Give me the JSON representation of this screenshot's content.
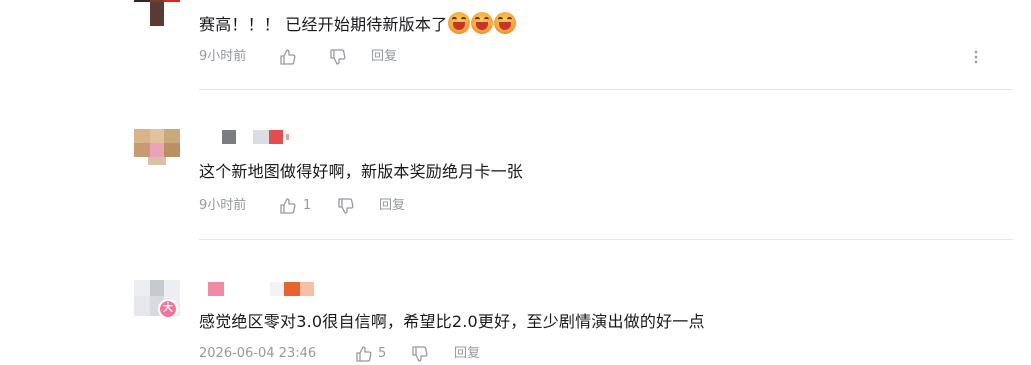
{
  "comments": [
    {
      "text": "赛高！！！ 已经开始期待新版本了",
      "emoji": [
        "laughing-emoji",
        "laughing-emoji",
        "laughing-emoji"
      ],
      "time": "9小时前",
      "likes": "",
      "reply_label": "回复"
    },
    {
      "text": "这个新地图做得好啊，新版本奖励绝月卡一张",
      "time": "9小时前",
      "likes": "1",
      "reply_label": "回复"
    },
    {
      "text": "感觉绝区零对3.0很自信啊，希望比2.0更好，至少剧情演出做的好一点",
      "time": "2026-06-04 23:46",
      "likes": "5",
      "reply_label": "回复",
      "avatar_badge": "大"
    }
  ],
  "colors": {
    "text": "#18191c",
    "meta": "#9499a0",
    "divider": "#e3e5e7",
    "badge": "#fb7299"
  }
}
